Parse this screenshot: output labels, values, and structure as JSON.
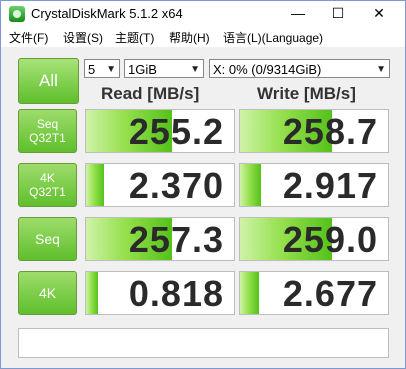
{
  "window": {
    "title": "CrystalDiskMark 5.1.2 x64",
    "controls": {
      "minimize": "—",
      "maximize": "☐",
      "close": "✕"
    }
  },
  "menu": [
    "文件(F)",
    "设置(S)",
    "主题(T)",
    "帮助(H)",
    "语言(L)(Language)"
  ],
  "toolbar": {
    "all_label": "All",
    "count": "5",
    "size": "1GiB",
    "drive": "X: 0% (0/9314GiB)"
  },
  "headers": {
    "read": "Read [MB/s]",
    "write": "Write [MB/s]"
  },
  "rows": [
    {
      "label_line1": "Seq",
      "label_line2": "Q32T1",
      "read": "255.2",
      "write": "258.7",
      "read_fill": 0.58,
      "write_fill": 0.62
    },
    {
      "label_line1": "4K",
      "label_line2": "Q32T1",
      "read": "2.370",
      "write": "2.917",
      "read_fill": 0.12,
      "write_fill": 0.14
    },
    {
      "label_line1": "Seq",
      "label_line2": "",
      "read": "257.3",
      "write": "259.0",
      "read_fill": 0.58,
      "write_fill": 0.62
    },
    {
      "label_line1": "4K",
      "label_line2": "",
      "read": "0.818",
      "write": "2.677",
      "read_fill": 0.08,
      "write_fill": 0.13
    }
  ],
  "comment": ""
}
